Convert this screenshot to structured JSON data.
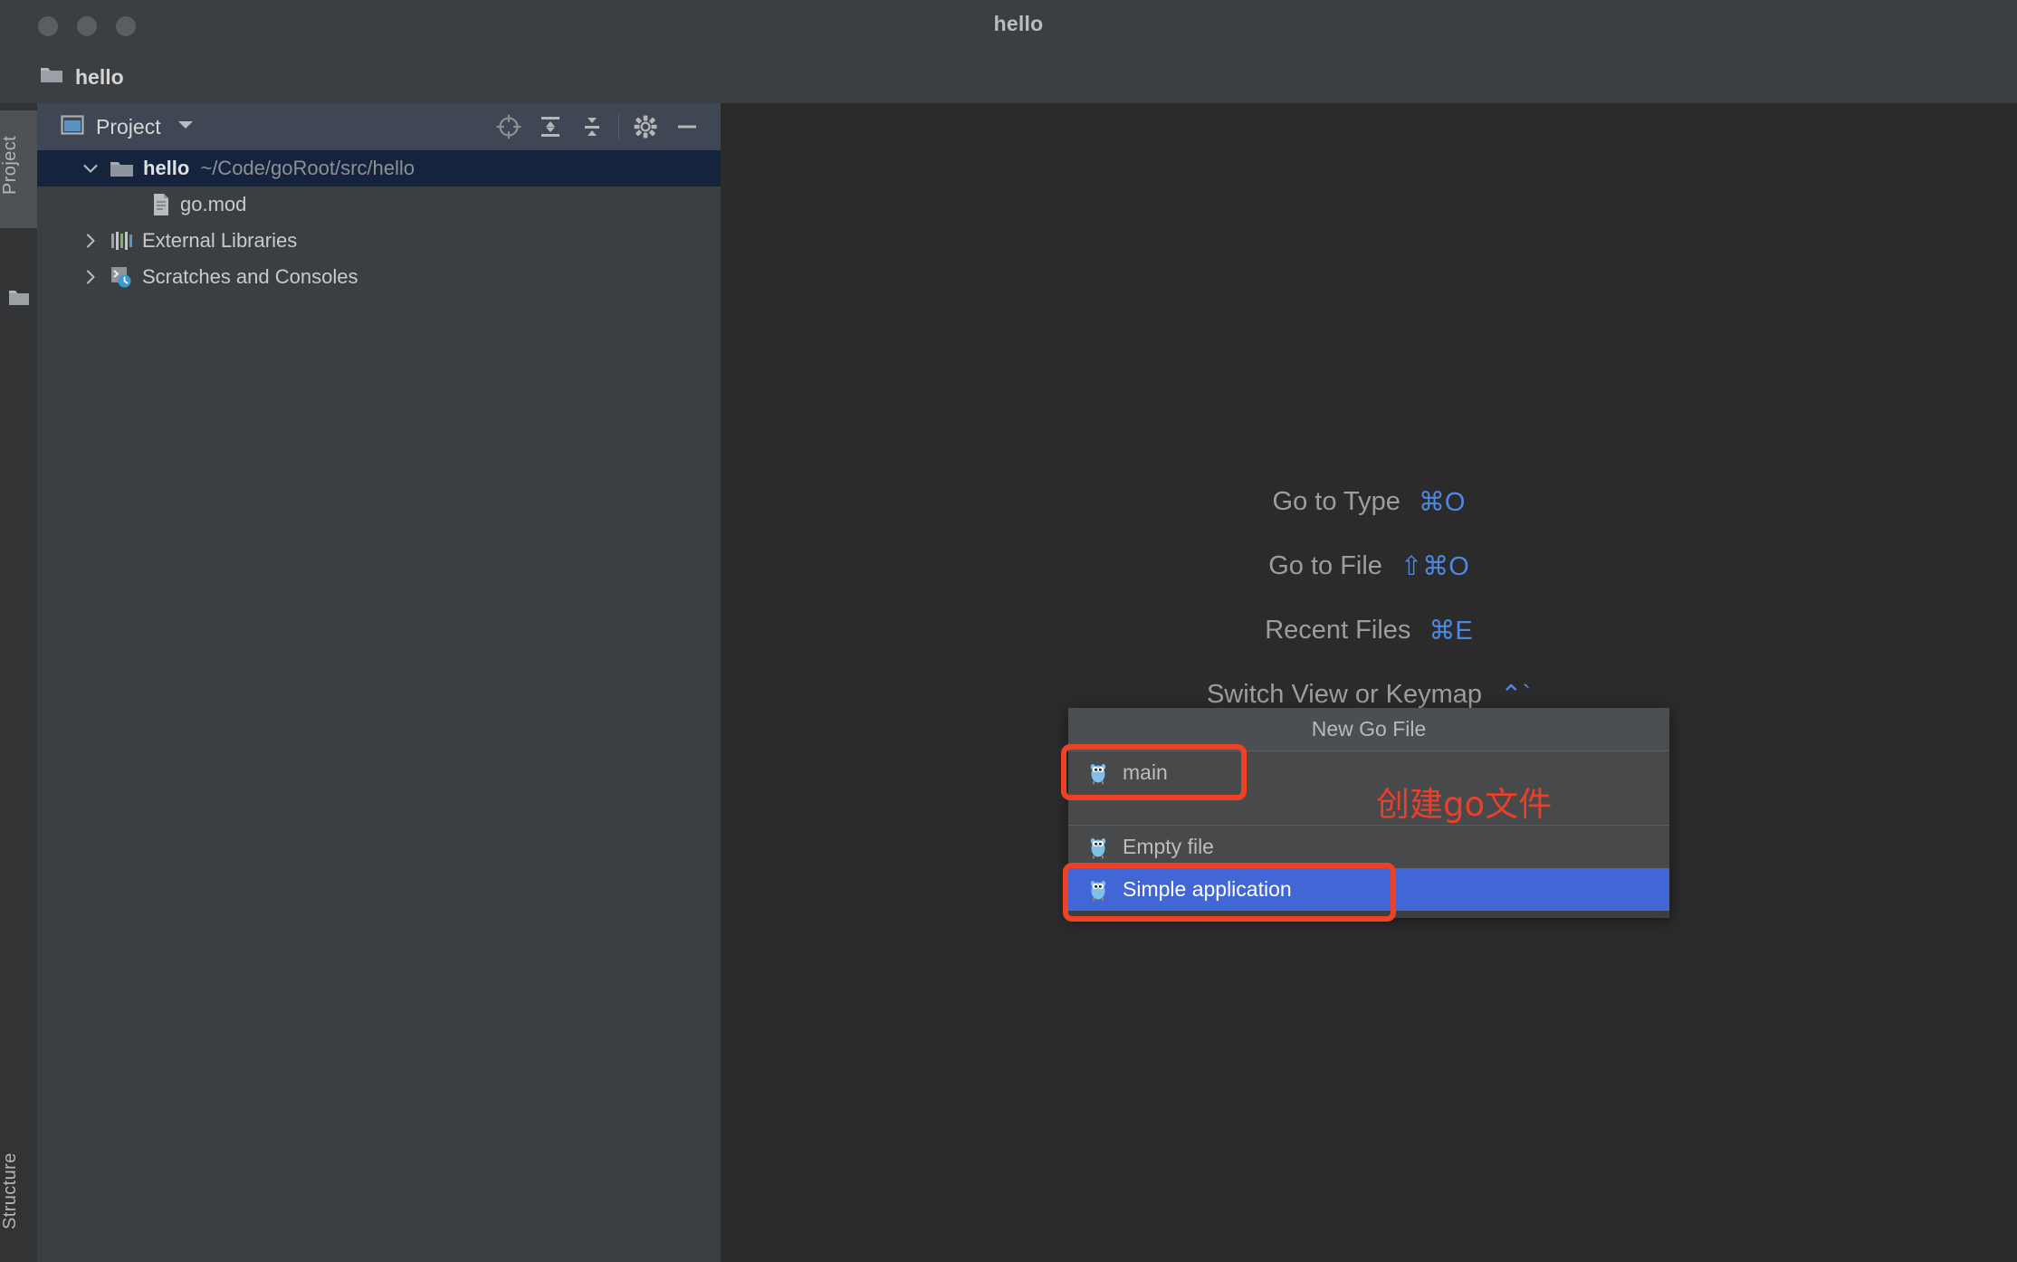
{
  "window": {
    "title": "hello",
    "traffic_lights": [
      "close-button",
      "minimize-button",
      "maximize-button"
    ]
  },
  "navbar": {
    "breadcrumb": "hello",
    "icon": "folder-icon"
  },
  "left_strip": {
    "tabs": [
      {
        "label": "Project",
        "icon": "folder-icon",
        "active": true
      },
      {
        "label": "Structure",
        "icon": "structure-icon",
        "active": false
      }
    ]
  },
  "project_panel": {
    "header": {
      "title": "Project",
      "icon": "project-view-icon",
      "caret": "chevron-down-icon"
    },
    "tools": [
      {
        "name": "locate-icon",
        "title": "Select Opened File"
      },
      {
        "name": "expand-all-icon",
        "title": "Expand All"
      },
      {
        "name": "collapse-all-icon",
        "title": "Collapse All"
      },
      {
        "name": "gear-icon",
        "title": "Settings"
      },
      {
        "name": "hide-icon",
        "title": "Hide"
      }
    ],
    "tree": [
      {
        "label": "hello",
        "path": "~/Code/goRoot/src/hello",
        "icon": "folder-icon",
        "arrow": "chevron-down-icon",
        "selected": true,
        "bold": true,
        "indent": 1
      },
      {
        "label": "go.mod",
        "path": "",
        "icon": "file-icon",
        "arrow": "",
        "selected": false,
        "bold": false,
        "indent": 2
      },
      {
        "label": "External Libraries",
        "path": "",
        "icon": "libraries-icon",
        "arrow": "chevron-right-icon",
        "selected": false,
        "bold": false,
        "indent": 1
      },
      {
        "label": "Scratches and Consoles",
        "path": "",
        "icon": "scratches-icon",
        "arrow": "chevron-right-icon",
        "selected": false,
        "bold": false,
        "indent": 1
      }
    ]
  },
  "editor": {
    "hints": [
      {
        "label": "Go to Type",
        "key": "⌘O"
      },
      {
        "label": "Go to File",
        "key": "⇧⌘O"
      },
      {
        "label": "Recent Files",
        "key": "⌘E"
      },
      {
        "label": "Switch View or Keymap",
        "key": "⌃`"
      }
    ]
  },
  "popup": {
    "header": "New Go File",
    "items": [
      {
        "label": "main",
        "icon": "go-gopher-icon",
        "selected": false
      },
      {
        "label": "Empty file",
        "icon": "go-gopher-icon",
        "selected": false
      },
      {
        "label": "Simple application",
        "icon": "go-gopher-icon",
        "selected": true
      }
    ]
  },
  "annotation": {
    "text": "创建go文件",
    "color": "#e8402a",
    "highlighted": [
      "main",
      "Simple application"
    ]
  },
  "colors": {
    "window_chrome": "#3c3f41",
    "editor_bg": "#2b2b2b",
    "panel_header": "#3f4754",
    "tree_selection": "#15243c",
    "popup_bg": "#47494b",
    "popup_header_bg": "#4b4f53",
    "selection_blue": "#4166d5",
    "hint_key_blue": "#4e88e0",
    "annotation_red": "#ef4123"
  }
}
